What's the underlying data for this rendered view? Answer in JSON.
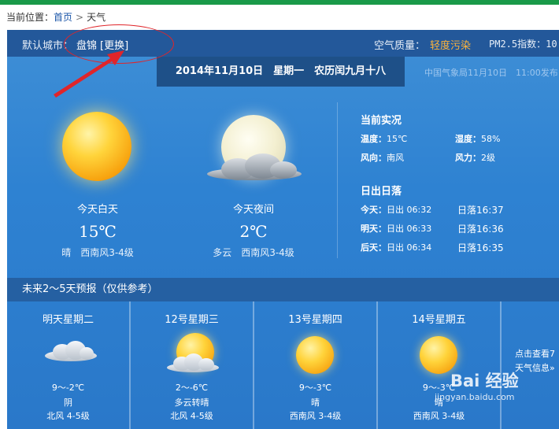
{
  "breadcrumb": {
    "prefix": "当前位置：",
    "home": "首页",
    "separator": ">",
    "current": "天气"
  },
  "city_bar": {
    "label": "默认城市：",
    "city": "盘锦",
    "change_button": "[更换]",
    "air_quality_label": "空气质量：",
    "air_quality_value": "轻度污染",
    "pm25_label": "PM2.5指数：10"
  },
  "date_line": "2014年11月10日　星期一　农历闰九月十八",
  "publish_info": "中国气象局11月10日　11:00发布",
  "today": {
    "day": {
      "label": "今天白天",
      "temp": "15℃",
      "desc": "晴　西南风3-4级",
      "icon": "sun-icon"
    },
    "night": {
      "label": "今天夜间",
      "temp": "2℃",
      "desc": "多云　西南风3-4级",
      "icon": "moon-cloud-icon"
    }
  },
  "current": {
    "title": "当前实况",
    "temp_label": "温度：",
    "temp_value": "15℃",
    "humidity_label": "湿度：",
    "humidity_value": "58%",
    "wind_dir_label": "风向：",
    "wind_dir_value": "南风",
    "wind_force_label": "风力：",
    "wind_force_value": "2级"
  },
  "sunrise": {
    "title": "日出日落",
    "rows": [
      {
        "day": "今天：",
        "rise": "日出 06:32",
        "set": "日落16:37"
      },
      {
        "day": "明天：",
        "rise": "日出 06:33",
        "set": "日落16:36"
      },
      {
        "day": "后天：",
        "rise": "日出 06:34",
        "set": "日落16:35"
      }
    ]
  },
  "forecast": {
    "header": "未来2～5天预报（仅供参考）",
    "days": [
      {
        "title": "明天星期二",
        "temp": "9～-2℃",
        "weather": "阴",
        "wind": "北风 4-5级",
        "icon": "cloud-icon"
      },
      {
        "title": "12号星期三",
        "temp": "2～-6℃",
        "weather": "多云转晴",
        "wind": "北风 4-5级",
        "icon": "sun-cloud-icon"
      },
      {
        "title": "13号星期四",
        "temp": "9～-3℃",
        "weather": "晴",
        "wind": "西南风 3-4级",
        "icon": "sun-icon"
      },
      {
        "title": "14号星期五",
        "temp": "9～-3℃",
        "weather": "晴",
        "wind": "西南风 3-4级",
        "icon": "sun-icon"
      }
    ],
    "more_line1": "点击查看7",
    "more_line2": "天气信息»"
  },
  "watermark": {
    "logo": "Bai 经验",
    "url": "jingyan.baidu.com"
  },
  "colors": {
    "top_bar": "#1a9a49",
    "panel_blue": "#2e82d2",
    "city_bar": "#23589a",
    "air_quality_accent": "#ffb43a",
    "annotation_red": "#e0252a"
  }
}
